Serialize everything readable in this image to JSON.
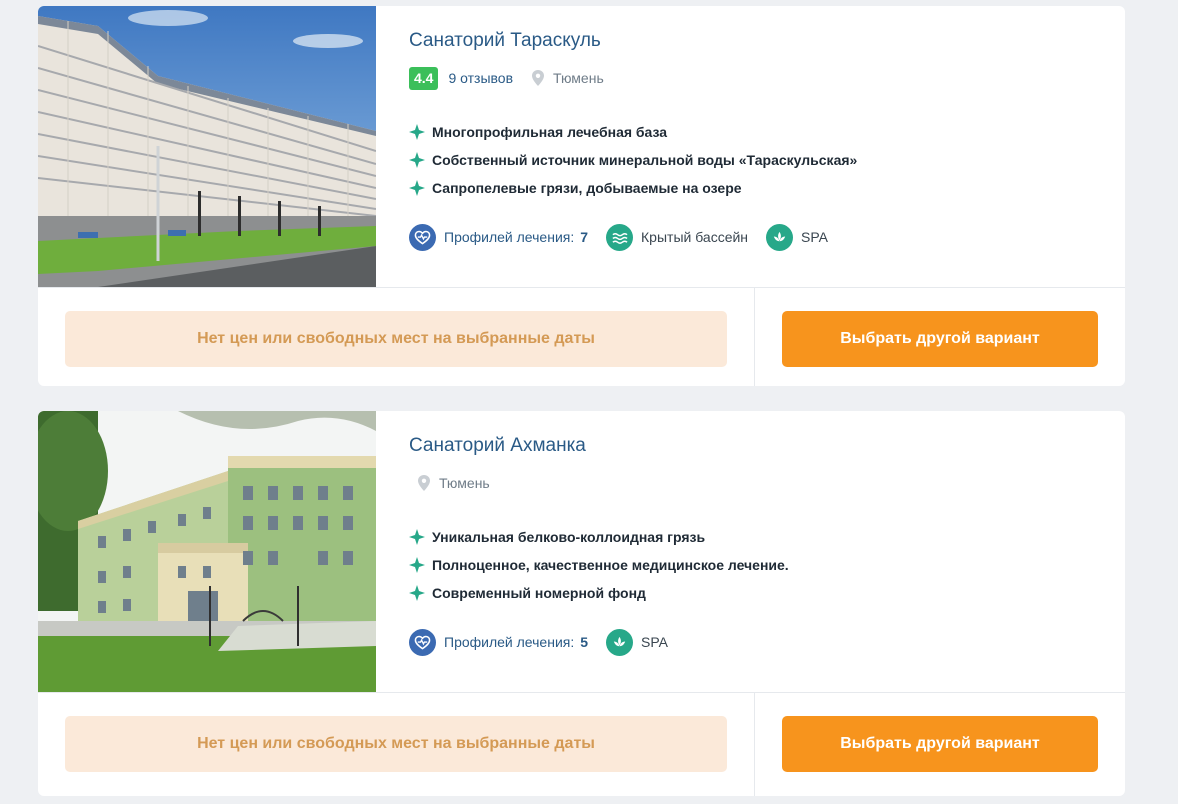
{
  "listings": [
    {
      "title": "Санаторий Тараскуль",
      "rating": "4.4",
      "reviews": "9 отзывов",
      "location": "Тюмень",
      "features": [
        "Многопрофильная лечебная база",
        "Собственный источник минеральной воды «Тараскульская»",
        "Сапропелевые грязи, добываемые на озере"
      ],
      "profile_label": "Профилей лечения:",
      "profile_count": "7",
      "amenity_pool": "Крытый бассейн",
      "amenity_spa": "SPA",
      "notice": "Нет цен или свободных мест на выбранные даты",
      "cta": "Выбрать другой вариант"
    },
    {
      "title": "Санаторий Ахманка",
      "location": "Тюмень",
      "features": [
        "Уникальная белково-коллоидная грязь",
        "Полноценное, качественное медицинское лечение.",
        "Современный номерной фонд"
      ],
      "profile_label": "Профилей лечения:",
      "profile_count": "5",
      "amenity_spa": "SPA",
      "notice": "Нет цен или свободных мест на выбранные даты",
      "cta": "Выбрать другой вариант"
    }
  ],
  "colors": {
    "title": "#2a5a86",
    "rating_bg": "#3bbf5a",
    "feature_icon": "#27a889",
    "notice_bg": "#fbe9d9",
    "notice_text": "#d49a55",
    "cta_bg": "#f7941d"
  },
  "icons": {
    "feature": "sparkle-icon",
    "location": "map-pin-icon",
    "profile": "heart-pulse-icon",
    "pool": "waves-icon",
    "spa": "lotus-icon"
  }
}
